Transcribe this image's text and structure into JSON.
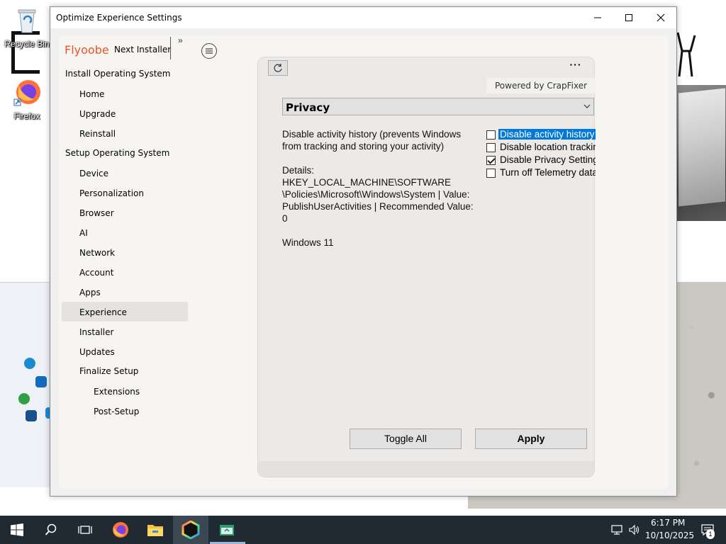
{
  "desktop": {
    "icons": [
      {
        "label": "Recycle Bin",
        "icon": "recycle-bin-icon"
      },
      {
        "label": "Firefox",
        "icon": "firefox-icon"
      }
    ]
  },
  "window": {
    "title": "Optimize Experience Settings",
    "controls": {
      "minimize": "minimize-icon",
      "maximize": "maximize-icon",
      "close": "close-icon"
    }
  },
  "sidebar": {
    "brand": "Flyoobe",
    "next_installer": "Next Installer",
    "collapse": "»",
    "groups": [
      {
        "label": "Install Operating System"
      },
      {
        "label": "Setup Operating System"
      }
    ],
    "items": [
      {
        "label": "Home"
      },
      {
        "label": "Upgrade"
      },
      {
        "label": "Reinstall"
      },
      {
        "label": "Device"
      },
      {
        "label": "Personalization"
      },
      {
        "label": "Browser"
      },
      {
        "label": "AI"
      },
      {
        "label": "Network"
      },
      {
        "label": "Account"
      },
      {
        "label": "Apps"
      },
      {
        "label": "Experience",
        "selected": true
      },
      {
        "label": "Installer"
      },
      {
        "label": "Updates"
      },
      {
        "label": "Finalize Setup"
      },
      {
        "label": "Extensions"
      },
      {
        "label": "Post-Setup"
      }
    ]
  },
  "content": {
    "more": "···",
    "powered_by": "Powered by CrapFixer",
    "category": "Privacy",
    "description": "Disable activity history (prevents Windows from tracking and storing your activity)",
    "details": "Details: HKEY_LOCAL_MACHINE\\SOFTWARE \\Policies\\Microsoft\\Windows\\System | Value: PublishUserActivities | Recommended Value: 0",
    "os": "Windows 11",
    "options": [
      {
        "label": "Disable activity history",
        "checked": false,
        "selected": true
      },
      {
        "label": "Disable location tracking",
        "checked": false,
        "selected": false
      },
      {
        "label": "Disable Privacy Settings",
        "checked": true,
        "selected": false
      },
      {
        "label": "Turn off Telemetry data",
        "checked": false,
        "selected": false
      }
    ],
    "toggle_all": "Toggle All",
    "apply": "Apply"
  },
  "taskbar": {
    "time": "6:17 PM",
    "date": "10/10/2025",
    "notifications": "1"
  },
  "colors": {
    "brand": "#e8562a",
    "selection": "#0078d7",
    "taskbar": "#1f2a33"
  }
}
